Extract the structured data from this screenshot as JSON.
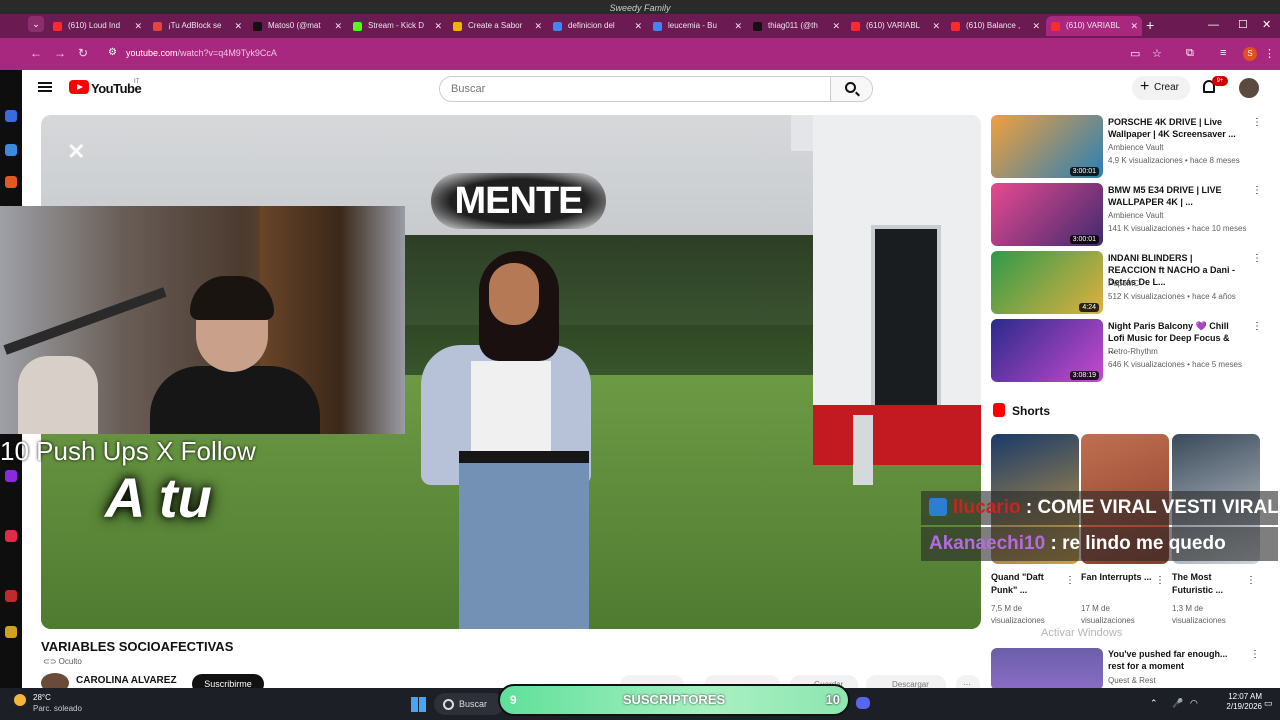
{
  "window": {
    "title": "Sweedy Family"
  },
  "tabs": [
    {
      "label": "(610) Loud Ind",
      "color": "#ff2a2a"
    },
    {
      "label": "¡Tu AdBlock se",
      "color": "#e8423c"
    },
    {
      "label": "Matos0 (@mat",
      "color": "#111111"
    },
    {
      "label": "Stream - Kick D",
      "color": "#53fc18"
    },
    {
      "label": "Create a Sabor",
      "color": "#f0b400"
    },
    {
      "label": "definicion del",
      "color": "#4285f4"
    },
    {
      "label": "leucemia - Bu",
      "color": "#4285f4"
    },
    {
      "label": "thiag011 (@th",
      "color": "#111111"
    },
    {
      "label": "(610) VARIABL",
      "color": "#ff2a2a"
    },
    {
      "label": "(610) Balance ,",
      "color": "#ff2a2a"
    },
    {
      "label": "(610) VARIABL",
      "color": "#ff2a2a"
    }
  ],
  "address": {
    "domain": "youtube.com",
    "path": "/watch?v=q4M9Tyk9CcA"
  },
  "profile": {
    "initial": "S"
  },
  "youtube": {
    "logo": "YouTube",
    "country": "IT",
    "search_placeholder": "Buscar",
    "create_label": "Crear",
    "notif_count": "9+",
    "video": {
      "overlay_mente": "MENTE",
      "overlay_atu": "A tu",
      "title": "VARIABLES SOCIOAFECTIVAS",
      "visibility": "Oculto",
      "channel": "CAROLINA ALVAREZ",
      "subscribe": "Suscribirme",
      "actions": [
        "",
        "",
        "Guardar",
        "Descargar"
      ]
    },
    "recommended": [
      {
        "title": "PORSCHE 4K DRIVE | Live Wallpaper | 4K Screensaver ...",
        "channel": "Ambience Vault",
        "meta": "4,9 K visualizaciones • hace 8 meses",
        "duration": "3:00:01",
        "color1": "#f2a03c",
        "color2": "#2a7fb8"
      },
      {
        "title": "BMW M5 E34 DRIVE | LIVE WALLPAPER 4K | ...",
        "channel": "Ambience Vault",
        "meta": "141 K visualizaciones • hace 10 meses",
        "duration": "3:00:01",
        "color1": "#e84a8f",
        "color2": "#402a6e"
      },
      {
        "title": "INDANI BLINDERS | REACCION ft NACHO a Dani - Detrás De L...",
        "channel": "PapoMC",
        "meta": "512 K visualizaciones • hace 4 años",
        "duration": "4:24",
        "color1": "#2e9a4a",
        "color2": "#e0b040"
      },
      {
        "title": "Night Paris Balcony 💜 Chill Lofi Music for Deep Focus & ...",
        "channel": "Retro-Rhythm",
        "meta": "646 K visualizaciones • hace 5 meses",
        "duration": "3:08:19",
        "color1": "#2a2a8a",
        "color2": "#c84ad0"
      }
    ],
    "shorts_header": "Shorts",
    "shorts": [
      {
        "title": "Quand \"Daft Punk\" ...",
        "meta": "7,5 M de visualizaciones",
        "color1": "#1a3a6a",
        "color2": "#d0a040"
      },
      {
        "title": "Fan Interrupts ...",
        "meta": "17 M de visualizaciones",
        "color1": "#c07050",
        "color2": "#8a3a2a"
      },
      {
        "title": "The Most Futuristic ...",
        "meta": "1,3 M de visualizaciones",
        "color1": "#3a4a5a",
        "color2": "#cfd4da"
      }
    ],
    "last_rec": {
      "title": "You've pushed far enough... rest for a moment",
      "channel": "Quest & Rest"
    }
  },
  "windows_watermark": "Activar Windows",
  "stream": {
    "pushups": "10 Push Ups X Follow",
    "chat": [
      {
        "user": "llucario",
        "msg": " : COME VIRAL VESTI VIRAL"
      },
      {
        "user": "Akanaechi10",
        "msg": " : re lindo me quedo"
      }
    ],
    "subs_goal": {
      "label": "SUSCRIPTORES",
      "current": "9",
      "target": "10"
    }
  },
  "taskbar": {
    "temperature": "28°C",
    "condition": "Parc. soleado",
    "search_label": "Buscar",
    "time": "12:07 AM",
    "date": "2/19/2026"
  }
}
